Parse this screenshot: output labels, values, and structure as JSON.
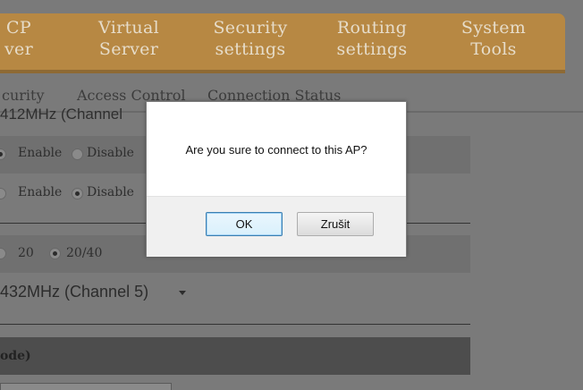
{
  "nav": {
    "items": [
      {
        "line1": "CP",
        "line2": "ver"
      },
      {
        "line1": "Virtual",
        "line2": "Server"
      },
      {
        "line1": "Security",
        "line2": "settings"
      },
      {
        "line1": "Routing",
        "line2": "settings"
      },
      {
        "line1": "System",
        "line2": "Tools"
      }
    ]
  },
  "subtabs": [
    "curity",
    "Access Control",
    "Connection Status"
  ],
  "partial_channel_text": "412MHz (Channel",
  "rows": {
    "row1": {
      "enable": "Enable",
      "disable": "Disable",
      "selected": "Enable"
    },
    "row2": {
      "enable": "Enable",
      "disable": "Disable",
      "selected": "Disable"
    },
    "bandwidth": {
      "opt1": "20",
      "opt2": "20/40",
      "selected": "20/40"
    }
  },
  "channel_select": {
    "value": "432MHz (Channel 5)"
  },
  "section_title": "ode)",
  "dialog": {
    "message": "Are you sure to connect to this AP?",
    "ok_label": "OK",
    "cancel_label": "Zrušit"
  }
}
